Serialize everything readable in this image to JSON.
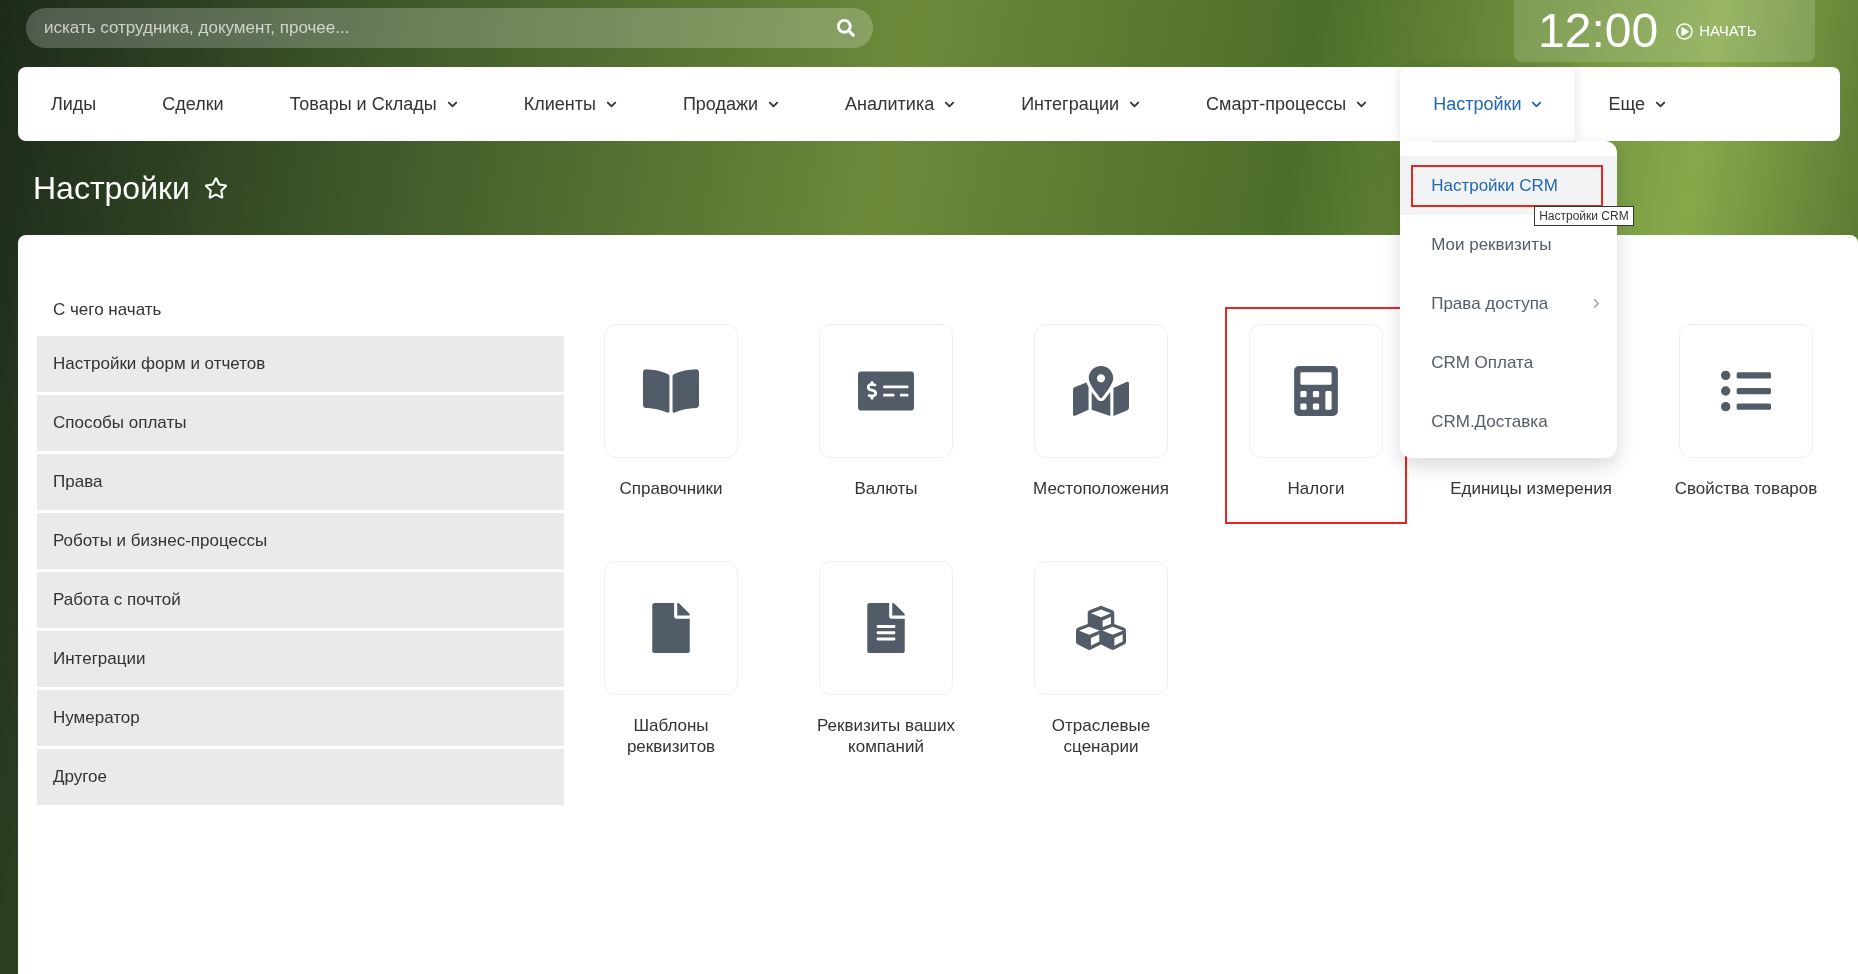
{
  "header": {
    "search": {
      "placeholder": "искать сотрудника, документ, прочее..."
    },
    "clock": "12:00",
    "start_button": "НАЧАТЬ"
  },
  "nav": {
    "items": [
      {
        "label": "Лиды",
        "has_menu": false,
        "selected": false
      },
      {
        "label": "Сделки",
        "has_menu": false,
        "selected": false
      },
      {
        "label": "Товары и Склады",
        "has_menu": true,
        "selected": false
      },
      {
        "label": "Клиенты",
        "has_menu": true,
        "selected": false
      },
      {
        "label": "Продажи",
        "has_menu": true,
        "selected": false
      },
      {
        "label": "Аналитика",
        "has_menu": true,
        "selected": false
      },
      {
        "label": "Интеграции",
        "has_menu": true,
        "selected": false
      },
      {
        "label": "Смарт-процессы",
        "has_menu": true,
        "selected": false
      },
      {
        "label": "Настройки",
        "has_menu": true,
        "selected": true,
        "menu": [
          {
            "label": "Настройки CRM",
            "selected": true,
            "marked": true,
            "has_submenu": false,
            "tooltip": "Настройки CRM"
          },
          {
            "label": "Мои реквизиты",
            "selected": false,
            "marked": false,
            "has_submenu": false
          },
          {
            "label": "Права доступа",
            "selected": false,
            "marked": false,
            "has_submenu": true
          },
          {
            "label": "CRM Оплата",
            "selected": false,
            "marked": false,
            "has_submenu": false
          },
          {
            "label": "CRM.Доставка",
            "selected": false,
            "marked": false,
            "has_submenu": false
          }
        ]
      },
      {
        "label": "Еще",
        "has_menu": true,
        "selected": false
      }
    ]
  },
  "page_title": "Настройки",
  "sidebar": {
    "title": "С чего начать",
    "items": [
      "Настройки форм и отчетов",
      "Способы оплаты",
      "Права",
      "Роботы и бизнес-процессы",
      "Работа с почтой",
      "Интеграции",
      "Нумератор",
      "Другое"
    ]
  },
  "tiles": [
    {
      "kind": "book",
      "label": "Справочники",
      "marked": false
    },
    {
      "kind": "currency",
      "label": "Валюты",
      "marked": false
    },
    {
      "kind": "map",
      "label": "Местоположения",
      "marked": false
    },
    {
      "kind": "calculator",
      "label": "Налоги",
      "marked": true
    },
    {
      "kind": "hidden",
      "label": "Единицы измерения",
      "marked": false
    },
    {
      "kind": "list",
      "label": "Свойства товаров",
      "marked": false
    },
    {
      "kind": "file",
      "label": "Шаблоны реквизитов",
      "marked": false
    },
    {
      "kind": "document",
      "label": "Реквизиты ваших компаний",
      "marked": false
    },
    {
      "kind": "cubes",
      "label": "Отраслевые сценарии",
      "marked": false
    }
  ]
}
